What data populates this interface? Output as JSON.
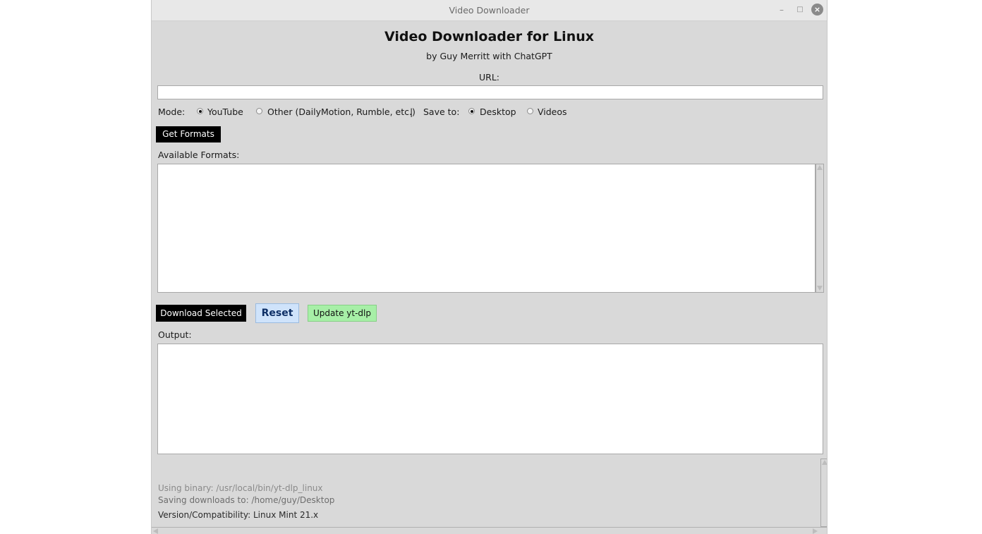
{
  "window": {
    "title": "Video Downloader",
    "minimize_glyph": "–",
    "maximize_glyph": "□",
    "close_glyph": "×"
  },
  "header": {
    "title": "Video Downloader for Linux",
    "subtitle": "by Guy Merritt with ChatGPT"
  },
  "url": {
    "label": "URL:",
    "value": ""
  },
  "mode": {
    "label": "Mode:",
    "options": [
      {
        "label": "YouTube",
        "selected": true
      },
      {
        "label": "Other (DailyMotion, Rumble, etc.)",
        "selected": false
      }
    ],
    "separator": "|"
  },
  "save_to": {
    "label": "Save to:",
    "options": [
      {
        "label": "Desktop",
        "selected": true
      },
      {
        "label": "Videos",
        "selected": false
      }
    ]
  },
  "buttons": {
    "get_formats": "Get Formats",
    "download_selected": "Download Selected",
    "reset": "Reset",
    "update": "Update yt-dlp"
  },
  "formats": {
    "label": "Available Formats:",
    "items": []
  },
  "output": {
    "label": "Output:",
    "text": ""
  },
  "status": {
    "binary": "Using binary: /usr/local/bin/yt-dlp_linux",
    "saving": "Saving downloads to: /home/guy/Desktop",
    "version": "Version/Compatibility: Linux Mint 21.x"
  },
  "colors": {
    "window_bg": "#d9d9d9",
    "black_button": "#000000",
    "reset_button": "#cfe3fb",
    "update_button": "#a7efa7"
  },
  "icons": {
    "minimize": "minimize-icon",
    "maximize": "maximize-icon",
    "close": "close-icon"
  }
}
